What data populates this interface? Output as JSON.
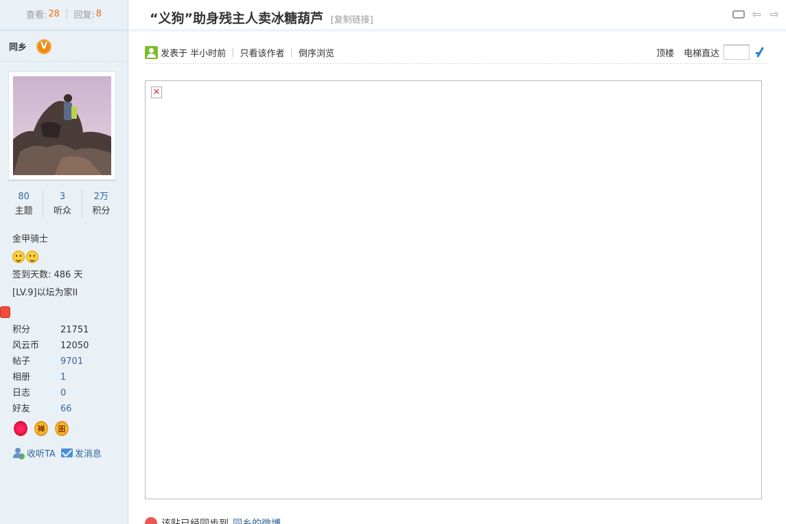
{
  "top_stats": {
    "views_label": "查看:",
    "views": "28",
    "replies_label": "回复:",
    "replies": "8"
  },
  "author": {
    "name": "同乡",
    "badge": "V"
  },
  "counts": [
    {
      "value": "80",
      "label": "主题"
    },
    {
      "value": "3",
      "label": "听众"
    },
    {
      "value": "2万",
      "label": "积分"
    }
  ],
  "profile": {
    "group": "金甲骑士",
    "signin": "签到天数: 486 天",
    "level": "[LV.9]以坛为家II"
  },
  "info": [
    {
      "k": "积分",
      "v": "21751"
    },
    {
      "k": "风云币",
      "v": "12050"
    },
    {
      "k": "帖子",
      "v": "9701"
    },
    {
      "k": "相册",
      "v": "1"
    },
    {
      "k": "日志",
      "v": "0"
    },
    {
      "k": "好友",
      "v": "66"
    }
  ],
  "medals": [
    "禅",
    "昍"
  ],
  "actions": {
    "follow": "收听TA",
    "message": "发消息"
  },
  "post": {
    "title": "“义狗”助身残主人卖冰糖葫芦",
    "copy_link": "[复制链接]",
    "posted": "发表于 半小时前",
    "only_author": "只看该作者",
    "reverse": "倒序浏览",
    "top_floor": "顶楼",
    "elevator": "电梯直达"
  },
  "bottom": {
    "text": "该贴已经同步到",
    "link": "同乡的微博"
  },
  "colors": {
    "sidebar_bg": "#e9f1f7",
    "link": "#336699",
    "accent": "#f26c0d"
  }
}
